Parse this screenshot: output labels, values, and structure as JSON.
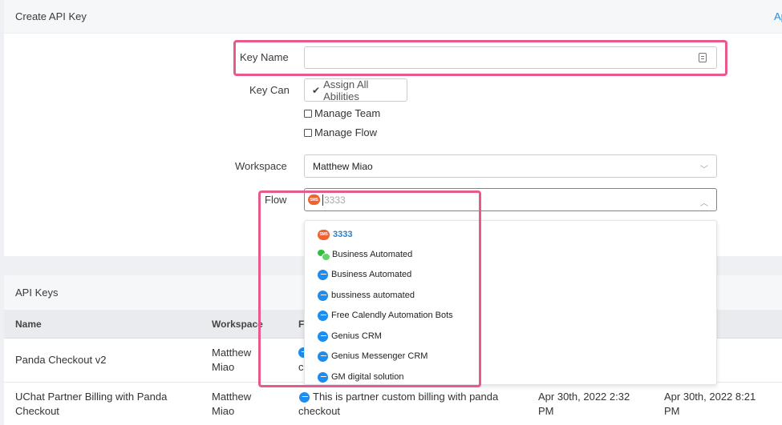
{
  "create_card": {
    "title": "Create API Key",
    "header_link": "Ap",
    "key_name_label": "Key Name",
    "key_name_value": "",
    "key_can_label": "Key Can",
    "assign_all_label": "Assign All Abilities",
    "abilities": [
      {
        "label": "Manage Team",
        "checked": false
      },
      {
        "label": "Manage Flow",
        "checked": false
      }
    ],
    "workspace_label": "Workspace",
    "workspace_value": "Matthew Miao",
    "flow_label": "Flow",
    "flow_input_value": "3333",
    "flow_options": [
      {
        "label": "3333",
        "icon": "sms-icon",
        "selected": true
      },
      {
        "label": "Business Automated",
        "icon": "wechat-icon",
        "selected": false
      },
      {
        "label": "Business Automated",
        "icon": "messenger-icon",
        "selected": false
      },
      {
        "label": "bussiness automated",
        "icon": "messenger-icon",
        "selected": false
      },
      {
        "label": "Free Calendly Automation Bots",
        "icon": "messenger-icon",
        "selected": false
      },
      {
        "label": "Genius CRM",
        "icon": "messenger-icon",
        "selected": false
      },
      {
        "label": "Genius Messenger CRM",
        "icon": "messenger-icon",
        "selected": false
      },
      {
        "label": "GM digital solution",
        "icon": "messenger-icon",
        "selected": false
      }
    ],
    "sms_badge_text": "SMS"
  },
  "api_keys": {
    "title": "API Keys",
    "columns": [
      "Name",
      "Workspace",
      "F"
    ],
    "rows": [
      {
        "name": "Panda Checkout v2",
        "workspace_line1": "Matthew",
        "workspace_line2": "Miao",
        "flow_fragment": "c",
        "created": "",
        "updated": ""
      },
      {
        "name_line1": "UChat Partner Billing with Panda",
        "name_line2": "Checkout",
        "workspace_line1": "Matthew",
        "workspace_line2": "Miao",
        "flow_line1": "This is partner custom billing with panda",
        "flow_line2": "checkout",
        "created_line1": "Apr 30th, 2022 2:32",
        "created_line2": "PM",
        "updated_line1": "Apr 30th, 2022 8:21",
        "updated_line2": "PM"
      }
    ]
  },
  "colors": {
    "highlight": "#e8598e",
    "link": "#2a8bd8",
    "messenger": "#1d8df0",
    "sms": "#f0622f"
  }
}
